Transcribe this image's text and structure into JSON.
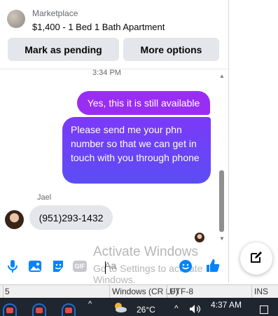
{
  "marketplace": {
    "label": "Marketplace",
    "title": "$1,400 - 1 Bed 1 Bath Apartment",
    "mark_pending": "Mark as pending",
    "more_options": "More options"
  },
  "conversation": {
    "timestamp": "3:34 PM",
    "outgoing": [
      "Yes, this it is still available",
      "Please send me your phn number so that we can get in touch with you through phone"
    ],
    "sender_name": "Jael",
    "incoming": "(951)293-1432"
  },
  "composer": {
    "placeholder": "Aa",
    "icons": [
      "microphone-icon",
      "image-icon",
      "sticker-icon",
      "gif-icon",
      "emoji-icon",
      "thumbs-up-icon"
    ],
    "gif_label": "GIF"
  },
  "watermark": {
    "line1": "Activate Windows",
    "line2": "Go to Settings to activate Windows."
  },
  "statusbar": {
    "col": "5",
    "line_endings": "Windows (CR LF)",
    "encoding": "UTF-8",
    "mode": "INS"
  },
  "taskbar": {
    "temperature": "26°C",
    "time": "4:37 AM"
  },
  "colors": {
    "accent_purple": "#9a2df4",
    "accent_blue": "#0084ff"
  }
}
